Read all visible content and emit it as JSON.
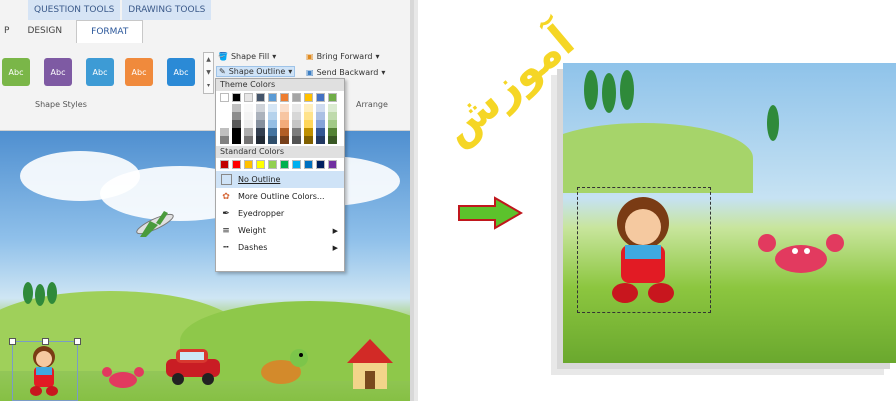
{
  "ribbon": {
    "context_tabs": [
      "QUESTION TOOLS",
      "DRAWING TOOLS"
    ],
    "tabs": [
      "P",
      "DESIGN",
      "FORMAT"
    ],
    "style_label": "Abc",
    "style_colors": [
      "#7ab648",
      "#7e5aa3",
      "#3d9bd5",
      "#f08a3c",
      "#2b8ad6"
    ],
    "group_shape_styles": "Shape Styles",
    "group_arrange": "Arrange",
    "shape_fill": "Shape Fill",
    "shape_outline": "Shape Outline",
    "bring_forward": "Bring Forward",
    "send_backward": "Send Backward"
  },
  "outline_menu": {
    "theme_colors_label": "Theme Colors",
    "standard_colors_label": "Standard Colors",
    "theme_top": [
      "#ffffff",
      "#000000",
      "#e7e6e6",
      "#44546a",
      "#5b9bd5",
      "#ed7d31",
      "#a5a5a5",
      "#ffc000",
      "#4472c4",
      "#70ad47"
    ],
    "standard": [
      "#c00000",
      "#ff0000",
      "#ffc000",
      "#ffff00",
      "#92d050",
      "#00b050",
      "#00b0f0",
      "#0070c0",
      "#002060",
      "#7030a0"
    ],
    "items": [
      {
        "label": "No Outline",
        "icon": "no-outline-icon"
      },
      {
        "label": "More Outline Colors...",
        "icon": "palette-icon"
      },
      {
        "label": "Eyedropper",
        "icon": "eyedropper-icon"
      },
      {
        "label": "Weight",
        "icon": "weight-icon"
      },
      {
        "label": "Dashes",
        "icon": "dashes-icon"
      }
    ]
  },
  "watermark": "آموزش"
}
